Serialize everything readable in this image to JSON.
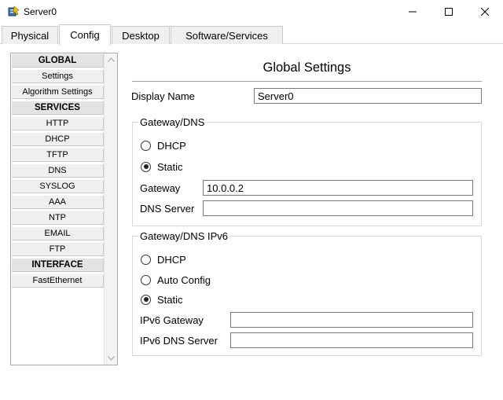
{
  "window": {
    "title": "Server0",
    "icon": "server-app-icon"
  },
  "tabs": [
    {
      "label": "Physical",
      "active": false
    },
    {
      "label": "Config",
      "active": true
    },
    {
      "label": "Desktop",
      "active": false
    },
    {
      "label": "Software/Services",
      "active": false
    }
  ],
  "nav": {
    "items": [
      {
        "label": "GLOBAL",
        "type": "header"
      },
      {
        "label": "Settings",
        "type": "item"
      },
      {
        "label": "Algorithm Settings",
        "type": "item"
      },
      {
        "label": "SERVICES",
        "type": "header"
      },
      {
        "label": "HTTP",
        "type": "item"
      },
      {
        "label": "DHCP",
        "type": "item"
      },
      {
        "label": "TFTP",
        "type": "item"
      },
      {
        "label": "DNS",
        "type": "item"
      },
      {
        "label": "SYSLOG",
        "type": "item"
      },
      {
        "label": "AAA",
        "type": "item"
      },
      {
        "label": "NTP",
        "type": "item"
      },
      {
        "label": "EMAIL",
        "type": "item"
      },
      {
        "label": "FTP",
        "type": "item"
      },
      {
        "label": "INTERFACE",
        "type": "header"
      },
      {
        "label": "FastEthernet",
        "type": "item"
      }
    ]
  },
  "main": {
    "title": "Global Settings",
    "display_name": {
      "label": "Display Name",
      "value": "Server0"
    },
    "gateway_dns": {
      "legend": "Gateway/DNS",
      "dhcp_label": "DHCP",
      "static_label": "Static",
      "selected": "static",
      "gateway": {
        "label": "Gateway",
        "value": "10.0.0.2"
      },
      "dns_server": {
        "label": "DNS Server",
        "value": ""
      }
    },
    "gateway_dns_ipv6": {
      "legend": "Gateway/DNS IPv6",
      "dhcp_label": "DHCP",
      "auto_config_label": "Auto Config",
      "static_label": "Static",
      "selected": "static",
      "ipv6_gateway": {
        "label": "IPv6 Gateway",
        "value": ""
      },
      "ipv6_dns_server": {
        "label": "IPv6 DNS Server",
        "value": ""
      }
    }
  }
}
